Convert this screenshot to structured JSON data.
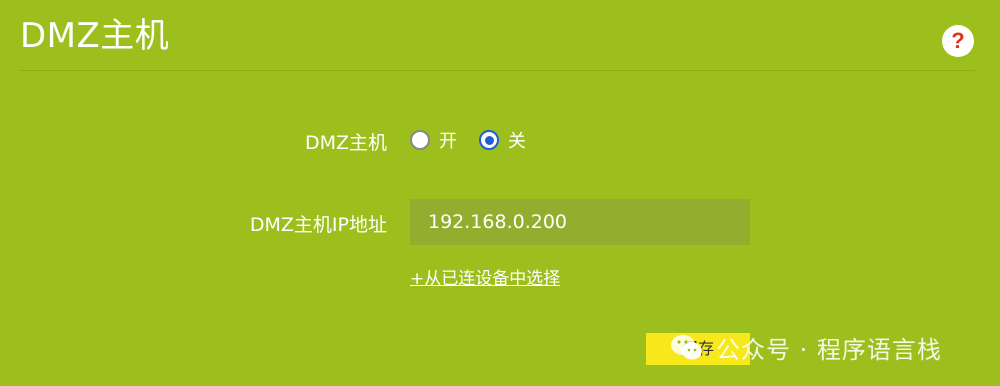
{
  "header": {
    "title": "DMZ主机",
    "help_icon_glyph": "?"
  },
  "form": {
    "dmz_label": "DMZ主机",
    "radio_on_label": "开",
    "radio_off_label": "关",
    "selected": "off",
    "ip_label": "DMZ主机IP地址",
    "ip_value": "192.168.0.200",
    "select_link": "+从已连设备中选择",
    "save_label": "保存"
  },
  "watermark": {
    "text": "公众号 · 程序语言栈",
    "icon": "wechat-icon"
  },
  "colors": {
    "background": "#9dbf1d",
    "input_bg": "#93ae2f",
    "save_button": "#f7e81c",
    "radio_checked": "#1f5fd6",
    "help_question": "#e0321e"
  }
}
